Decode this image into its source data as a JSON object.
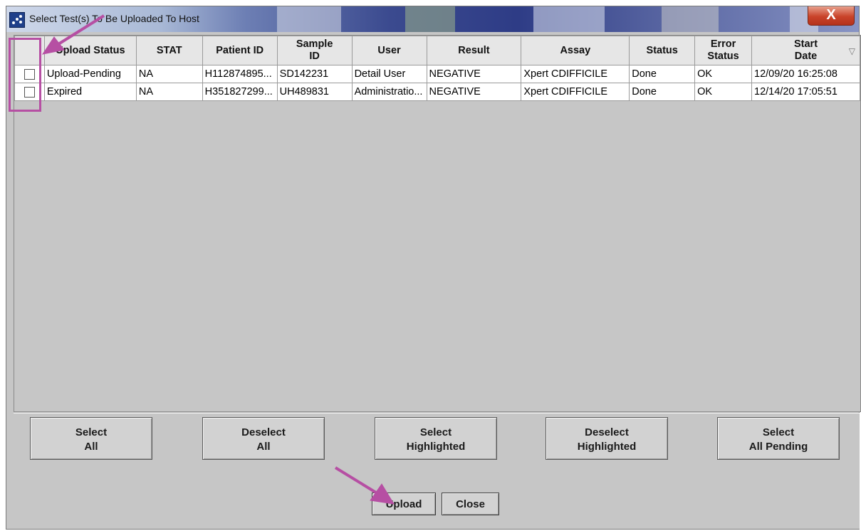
{
  "window": {
    "title": "Select Test(s) To Be Uploaded To Host",
    "close_glyph": "X"
  },
  "table": {
    "columns": [
      {
        "key": "select",
        "label": ""
      },
      {
        "key": "upload_status",
        "label": "Upload Status"
      },
      {
        "key": "stat",
        "label": "STAT"
      },
      {
        "key": "patient_id",
        "label": "Patient ID"
      },
      {
        "key": "sample_id",
        "label": "Sample ID"
      },
      {
        "key": "user",
        "label": "User"
      },
      {
        "key": "result",
        "label": "Result"
      },
      {
        "key": "assay",
        "label": "Assay"
      },
      {
        "key": "status",
        "label": "Status"
      },
      {
        "key": "error_status",
        "label": "Error Status"
      },
      {
        "key": "start_date",
        "label": "Start Date"
      }
    ],
    "header_lines": {
      "upload_status": [
        "Upload Status"
      ],
      "stat": [
        "STAT"
      ],
      "patient_id": [
        "Patient ID"
      ],
      "sample_id": [
        "Sample",
        "ID"
      ],
      "user": [
        "User"
      ],
      "result": [
        "Result"
      ],
      "assay": [
        "Assay"
      ],
      "status": [
        "Status"
      ],
      "error_status": [
        "Error",
        "Status"
      ],
      "start_date": [
        "Start",
        "Date"
      ]
    },
    "sort_indicator": "▽",
    "rows": [
      {
        "checked": false,
        "upload_status": "Upload-Pending",
        "stat": "NA",
        "patient_id": "H112874895...",
        "sample_id": "SD142231",
        "user": "Detail User",
        "result": "NEGATIVE",
        "assay": "Xpert CDIFFICILE",
        "status": "Done",
        "error_status": "OK",
        "start_date": "12/09/20 16:25:08"
      },
      {
        "checked": false,
        "upload_status": "Expired",
        "stat": "NA",
        "patient_id": "H351827299...",
        "sample_id": "UH489831",
        "user": "Administratio...",
        "result": "NEGATIVE",
        "assay": "Xpert CDIFFICILE",
        "status": "Done",
        "error_status": "OK",
        "start_date": "12/14/20 17:05:51"
      }
    ]
  },
  "buttons": {
    "select_all": [
      "Select",
      "All"
    ],
    "deselect_all": [
      "Deselect",
      "All"
    ],
    "select_highlighted": [
      "Select",
      "Highlighted"
    ],
    "deselect_highlighted": [
      "Deselect",
      "Highlighted"
    ],
    "select_all_pending": [
      "Select",
      "All Pending"
    ],
    "upload": "Upload",
    "close": "Close"
  },
  "annotations": {
    "color": "#b64fa3",
    "highlight": "checkbox-column"
  },
  "icons": {
    "window": "app-window-icon",
    "close": "close-x-icon",
    "sort": "sort-descending-icon"
  }
}
